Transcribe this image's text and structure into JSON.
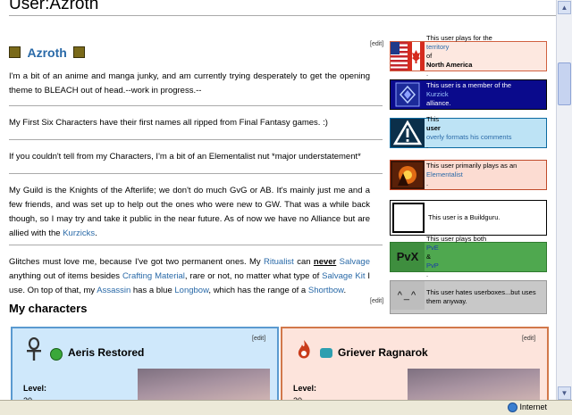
{
  "page": {
    "title": "User:Azroth"
  },
  "header": {
    "name": "Azroth",
    "edit_label": "[edit]"
  },
  "paragraphs": {
    "p1": "I'm a bit of an anime and manga junky, and am currently trying desperately to get the opening theme to BLEACH out of head.--work in progress.--",
    "p2": "My First Six Characters have their first names all ripped from Final Fantasy games. :)",
    "p3": "If you couldn't tell from my Characters, I'm a bit of an Elementalist nut *major understatement*",
    "p4_a": "My Guild is the Knights of the Afterlife; we don't do much GvG or AB. It's mainly just me and a few friends, and was set up to help out the ones who were new to GW. That was a while back though, so I may try and take it public in the near future. As of now we have no Alliance but are allied with the ",
    "p4_link": "Kurzicks",
    "p4_b": ".",
    "p5": {
      "t1": "Glitches must love me, because I've got two permanent ones. My ",
      "l1": "Ritualist",
      "t2": " can ",
      "never": "never",
      "t3": " ",
      "l2": "Salvage",
      "t4": " anything out of items besides ",
      "l3": "Crafting Material",
      "t5": ", rare or not, no matter what type of ",
      "l4": "Salvage Kit",
      "t6": " I use. On top of that, my ",
      "l5": "Assassin",
      "t7": " has a blue ",
      "l6": "Longbow",
      "t8": ", which has the range of a ",
      "l7": "Shortbow",
      "t9": "."
    }
  },
  "section": {
    "title": "My characters",
    "edit_label": "[edit]"
  },
  "userboxes": [
    {
      "id": "na",
      "t1": "This user plays for the ",
      "link": "territory",
      "t2": " of ",
      "bold": "North America",
      "t3": ".",
      "bg": "#fde8e0",
      "border": "#d06040"
    },
    {
      "id": "kurzick",
      "t1": "This user is a member of the ",
      "link": "Kurzick",
      "t2": " alliance.",
      "bg": "#0a0a8c",
      "text_color": "#ffffff"
    },
    {
      "id": "overly",
      "t1": "This ",
      "bold": "user",
      "link": "overly formats his comments",
      "t2": ".",
      "bg": "#bde3f5",
      "border": "#0b6aa0"
    },
    {
      "id": "ele",
      "t1": "This user primarily plays as an ",
      "link": "Elementalist",
      "t2": ".",
      "bg": "#fcdcd2",
      "border": "#c04a2a"
    },
    {
      "id": "buildguru",
      "t1": "This user is a Buildguru.",
      "bg": "#ffffff",
      "border": "#000000"
    },
    {
      "id": "pvx",
      "icon_text": "PvX",
      "t1": "This user plays both ",
      "link": "PvE",
      "t2": " & ",
      "link2": "PvP",
      "t3": ".",
      "bg": "#4fa84f"
    },
    {
      "id": "userbox-hate",
      "icon_text": "^_^",
      "t1": "This user hates userboxes...but uses them anyway.",
      "bg": "#c8c8c8"
    }
  ],
  "characters": [
    {
      "name": "Aeris Restored",
      "level_label": "Level:",
      "level": "20",
      "edit_label": "[edit]",
      "bg": "#cfe8fb",
      "border": "#5a9ad0"
    },
    {
      "name": "Griever Ragnarok",
      "level_label": "Level:",
      "level": "20",
      "edit_label": "[edit]",
      "bg": "#fde4dc",
      "border": "#d2784a"
    }
  ],
  "status": {
    "zone": "Internet"
  }
}
